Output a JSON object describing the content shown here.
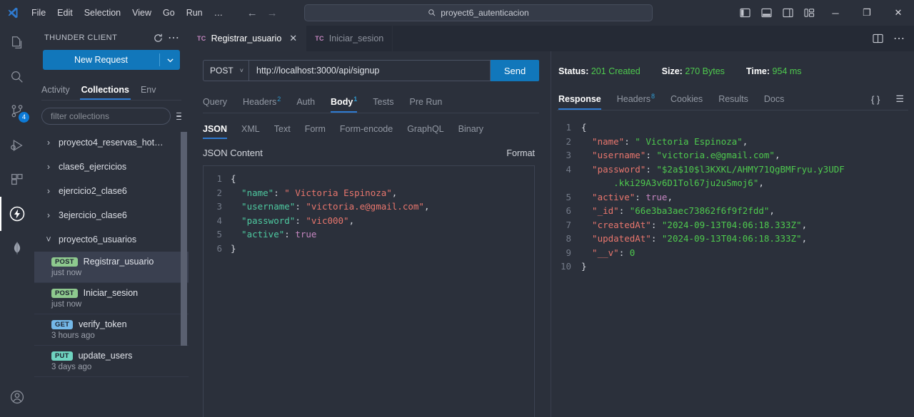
{
  "titlebar": {
    "logo_icon": "vscode-logo",
    "menu": [
      "File",
      "Edit",
      "Selection",
      "View",
      "Go",
      "Run",
      "…"
    ],
    "nav": {
      "back_icon": "arrow-left-icon",
      "forward_icon": "arrow-right-icon"
    },
    "search": {
      "icon": "search-icon",
      "value": "proyect6_autenticacion"
    },
    "layout_icons": [
      "toggle-primary-sidebar-icon",
      "toggle-panel-icon",
      "toggle-secondary-sidebar-icon",
      "customize-layout-icon"
    ],
    "window_controls": {
      "minimize": "─",
      "maximize": "❐",
      "close": "✕"
    }
  },
  "activitybar": {
    "items": [
      {
        "name": "explorer",
        "icon": "files-icon",
        "active": false,
        "badge": ""
      },
      {
        "name": "search",
        "icon": "search-icon",
        "active": false,
        "badge": ""
      },
      {
        "name": "source-control",
        "icon": "source-control-icon",
        "active": false,
        "badge": "4"
      },
      {
        "name": "run-and-debug",
        "icon": "run-debug-icon",
        "active": false,
        "badge": ""
      },
      {
        "name": "extensions",
        "icon": "extensions-icon",
        "active": false,
        "badge": ""
      },
      {
        "name": "thunder-client",
        "icon": "thunder-bolt-icon",
        "active": true,
        "badge": ""
      },
      {
        "name": "mongodb",
        "icon": "mongodb-leaf-icon",
        "active": false,
        "badge": ""
      }
    ],
    "accounts_icon": "account-icon"
  },
  "sidebar": {
    "title": "THUNDER CLIENT",
    "refresh_icon": "refresh-icon",
    "more_icon": "more-actions-icon",
    "new_request": {
      "label": "New Request",
      "caret_icon": "chevron-down-icon"
    },
    "tabs": [
      {
        "label": "Activity",
        "active": false
      },
      {
        "label": "Collections",
        "active": true
      },
      {
        "label": "Env",
        "active": false
      }
    ],
    "filter": {
      "placeholder": "filter collections",
      "menu_icon": "menu-icon"
    },
    "collections": [
      {
        "name": "proyecto4_reservas_hot…",
        "expanded": false
      },
      {
        "name": "clase6_ejercicios",
        "expanded": false
      },
      {
        "name": "ejercicio2_clase6",
        "expanded": false
      },
      {
        "name": "3ejercicio_clase6",
        "expanded": false
      },
      {
        "name": "proyecto6_usuarios",
        "expanded": true
      }
    ],
    "requests": [
      {
        "method": "POST",
        "name": "Registrar_usuario",
        "time": "just now",
        "selected": true
      },
      {
        "method": "POST",
        "name": "Iniciar_sesion",
        "time": "just now",
        "selected": false
      },
      {
        "method": "GET",
        "name": "verify_token",
        "time": "3 hours ago",
        "selected": false
      },
      {
        "method": "PUT",
        "name": "update_users",
        "time": "3 days ago",
        "selected": false
      }
    ]
  },
  "editor": {
    "tabs": [
      {
        "icon": "TC",
        "label": "Registrar_usuario",
        "active": true,
        "close_icon": "✕"
      },
      {
        "icon": "TC",
        "label": "Iniciar_sesion",
        "active": false,
        "close_icon": ""
      }
    ],
    "actions": [
      {
        "name": "split-editor",
        "icon": "split-editor-icon"
      },
      {
        "name": "more-actions",
        "icon": "more-actions-icon"
      }
    ]
  },
  "request": {
    "method": "POST",
    "method_caret_icon": "chevron-down-icon",
    "url": "http://localhost:3000/api/signup",
    "send_label": "Send",
    "tabs": [
      {
        "label": "Query",
        "badge": "",
        "active": false
      },
      {
        "label": "Headers",
        "badge": "2",
        "active": false
      },
      {
        "label": "Auth",
        "badge": "",
        "active": false
      },
      {
        "label": "Body",
        "badge": "1",
        "active": true
      },
      {
        "label": "Tests",
        "badge": "",
        "active": false
      },
      {
        "label": "Pre Run",
        "badge": "",
        "active": false
      }
    ],
    "body_formats": [
      {
        "label": "JSON",
        "active": true
      },
      {
        "label": "XML",
        "active": false
      },
      {
        "label": "Text",
        "active": false
      },
      {
        "label": "Form",
        "active": false
      },
      {
        "label": "Form-encode",
        "active": false
      },
      {
        "label": "GraphQL",
        "active": false
      },
      {
        "label": "Binary",
        "active": false
      }
    ],
    "json_content_label": "JSON Content",
    "format_label": "Format",
    "body_lines": [
      {
        "n": "1",
        "segments": [
          {
            "t": "{",
            "c": "punc"
          }
        ]
      },
      {
        "n": "2",
        "segments": [
          {
            "t": "  \"name\"",
            "c": "k-req"
          },
          {
            "t": ": ",
            "c": "punc"
          },
          {
            "t": "\" Victoria Espinoza\"",
            "c": "s-req"
          },
          {
            "t": ",",
            "c": "punc"
          }
        ]
      },
      {
        "n": "3",
        "segments": [
          {
            "t": "  \"username\"",
            "c": "k-req"
          },
          {
            "t": ": ",
            "c": "punc"
          },
          {
            "t": "\"victoria.e@gmail.com\"",
            "c": "s-req"
          },
          {
            "t": ",",
            "c": "punc"
          }
        ]
      },
      {
        "n": "4",
        "segments": [
          {
            "t": "  \"password\"",
            "c": "k-req"
          },
          {
            "t": ": ",
            "c": "punc"
          },
          {
            "t": "\"vic000\"",
            "c": "s-req"
          },
          {
            "t": ",",
            "c": "punc"
          }
        ]
      },
      {
        "n": "5",
        "segments": [
          {
            "t": "  \"active\"",
            "c": "k-req"
          },
          {
            "t": ": ",
            "c": "punc"
          },
          {
            "t": "true",
            "c": "bool"
          }
        ]
      },
      {
        "n": "6",
        "segments": [
          {
            "t": "}",
            "c": "punc"
          }
        ]
      }
    ]
  },
  "response": {
    "status_label": "Status:",
    "status_value": "201 Created",
    "size_label": "Size:",
    "size_value": "270 Bytes",
    "time_label": "Time:",
    "time_value": "954 ms",
    "tabs": [
      {
        "label": "Response",
        "badge": "",
        "active": true
      },
      {
        "label": "Headers",
        "badge": "8",
        "active": false
      },
      {
        "label": "Cookies",
        "badge": "",
        "active": false
      },
      {
        "label": "Results",
        "badge": "",
        "active": false
      },
      {
        "label": "Docs",
        "badge": "",
        "active": false
      }
    ],
    "right_icons": [
      {
        "name": "format-json-icon",
        "glyph": "{ }"
      },
      {
        "name": "view-lines-icon",
        "glyph": "☰"
      }
    ],
    "body_lines": [
      {
        "n": "1",
        "segments": [
          {
            "t": "{",
            "c": "punc"
          }
        ]
      },
      {
        "n": "2",
        "segments": [
          {
            "t": "  \"name\"",
            "c": "k-res"
          },
          {
            "t": ": ",
            "c": "punc"
          },
          {
            "t": "\" Victoria Espinoza\"",
            "c": "s-res"
          },
          {
            "t": ",",
            "c": "punc"
          }
        ]
      },
      {
        "n": "3",
        "segments": [
          {
            "t": "  \"username\"",
            "c": "k-res"
          },
          {
            "t": ": ",
            "c": "punc"
          },
          {
            "t": "\"victoria.e@gmail.com\"",
            "c": "s-res"
          },
          {
            "t": ",",
            "c": "punc"
          }
        ]
      },
      {
        "n": "4",
        "segments": [
          {
            "t": "  \"password\"",
            "c": "k-res"
          },
          {
            "t": ": ",
            "c": "punc"
          },
          {
            "t": "\"$2a$10$l3KXKL/AHMY71QgBMFryu.y3UDF",
            "c": "s-res"
          }
        ]
      },
      {
        "n": "",
        "segments": [
          {
            "t": "      .kki29A3v6D1Tol67ju2uSmoj6\"",
            "c": "s-res"
          },
          {
            "t": ",",
            "c": "punc"
          }
        ]
      },
      {
        "n": "5",
        "segments": [
          {
            "t": "  \"active\"",
            "c": "k-res"
          },
          {
            "t": ": ",
            "c": "punc"
          },
          {
            "t": "true",
            "c": "bool"
          },
          {
            "t": ",",
            "c": "punc"
          }
        ]
      },
      {
        "n": "6",
        "segments": [
          {
            "t": "  \"_id\"",
            "c": "k-res"
          },
          {
            "t": ": ",
            "c": "punc"
          },
          {
            "t": "\"66e3ba3aec73862f6f9f2fdd\"",
            "c": "s-res"
          },
          {
            "t": ",",
            "c": "punc"
          }
        ]
      },
      {
        "n": "7",
        "segments": [
          {
            "t": "  \"createdAt\"",
            "c": "k-res"
          },
          {
            "t": ": ",
            "c": "punc"
          },
          {
            "t": "\"2024-09-13T04:06:18.333Z\"",
            "c": "s-res"
          },
          {
            "t": ",",
            "c": "punc"
          }
        ]
      },
      {
        "n": "8",
        "segments": [
          {
            "t": "  \"updatedAt\"",
            "c": "k-res"
          },
          {
            "t": ": ",
            "c": "punc"
          },
          {
            "t": "\"2024-09-13T04:06:18.333Z\"",
            "c": "s-res"
          },
          {
            "t": ",",
            "c": "punc"
          }
        ]
      },
      {
        "n": "9",
        "segments": [
          {
            "t": "  \"__v\"",
            "c": "k-res"
          },
          {
            "t": ": ",
            "c": "punc"
          },
          {
            "t": "0",
            "c": "num"
          }
        ]
      },
      {
        "n": "10",
        "segments": [
          {
            "t": "}",
            "c": "punc"
          }
        ]
      }
    ]
  }
}
